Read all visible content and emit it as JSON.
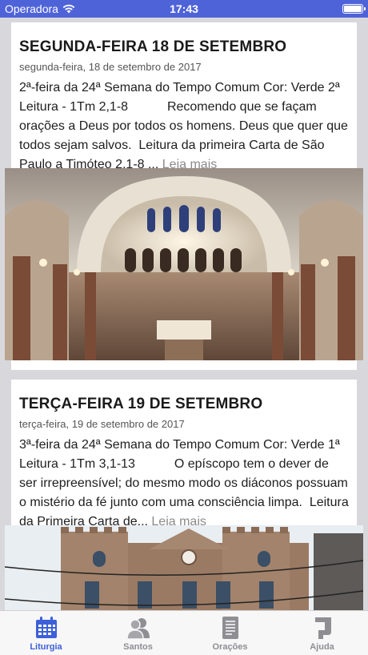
{
  "status_bar": {
    "carrier": "Operadora",
    "time": "17:43"
  },
  "cards": [
    {
      "title": "SEGUNDA-FEIRA 18 DE SETEMBRO",
      "date": "segunda-feira, 18 de setembro de 2017",
      "excerpt": "2ª-feira da 24ª Semana do Tempo Comum Cor: Verde 2ª Leitura - 1Tm 2,1-8           Recomendo que se façam orações a Deus por todos os homens. Deus que quer que todos sejam salvos.  Leitura da primeira Carta de São Paulo a Timóteo 2,1-8 ... ",
      "read_more": "Leia mais"
    },
    {
      "title": "TERÇA-FEIRA 19 DE SETEMBRO",
      "date": "terça-feira, 19 de setembro de 2017",
      "excerpt": "3ª-feira da 24ª Semana do Tempo Comum Cor: Verde 1ª Leitura - 1Tm 3,1-13           O epíscopo tem o dever de ser irrepreensível; do mesmo modo os diáconos possuam o mistério da fé junto com uma consciência limpa.  Leitura da Primeira Carta de... ",
      "read_more": "Leia mais"
    }
  ],
  "tabs": [
    {
      "label": "Liturgia",
      "icon": "calendar-icon",
      "active": true
    },
    {
      "label": "Santos",
      "icon": "people-icon",
      "active": false
    },
    {
      "label": "Orações",
      "icon": "document-icon",
      "active": false
    },
    {
      "label": "Ajuda",
      "icon": "help-icon",
      "active": false
    }
  ],
  "colors": {
    "accent": "#3d60d8",
    "status_bar": "#4f63d9",
    "inactive_tab": "#8e8e93",
    "read_more": "#8a8a8a"
  }
}
